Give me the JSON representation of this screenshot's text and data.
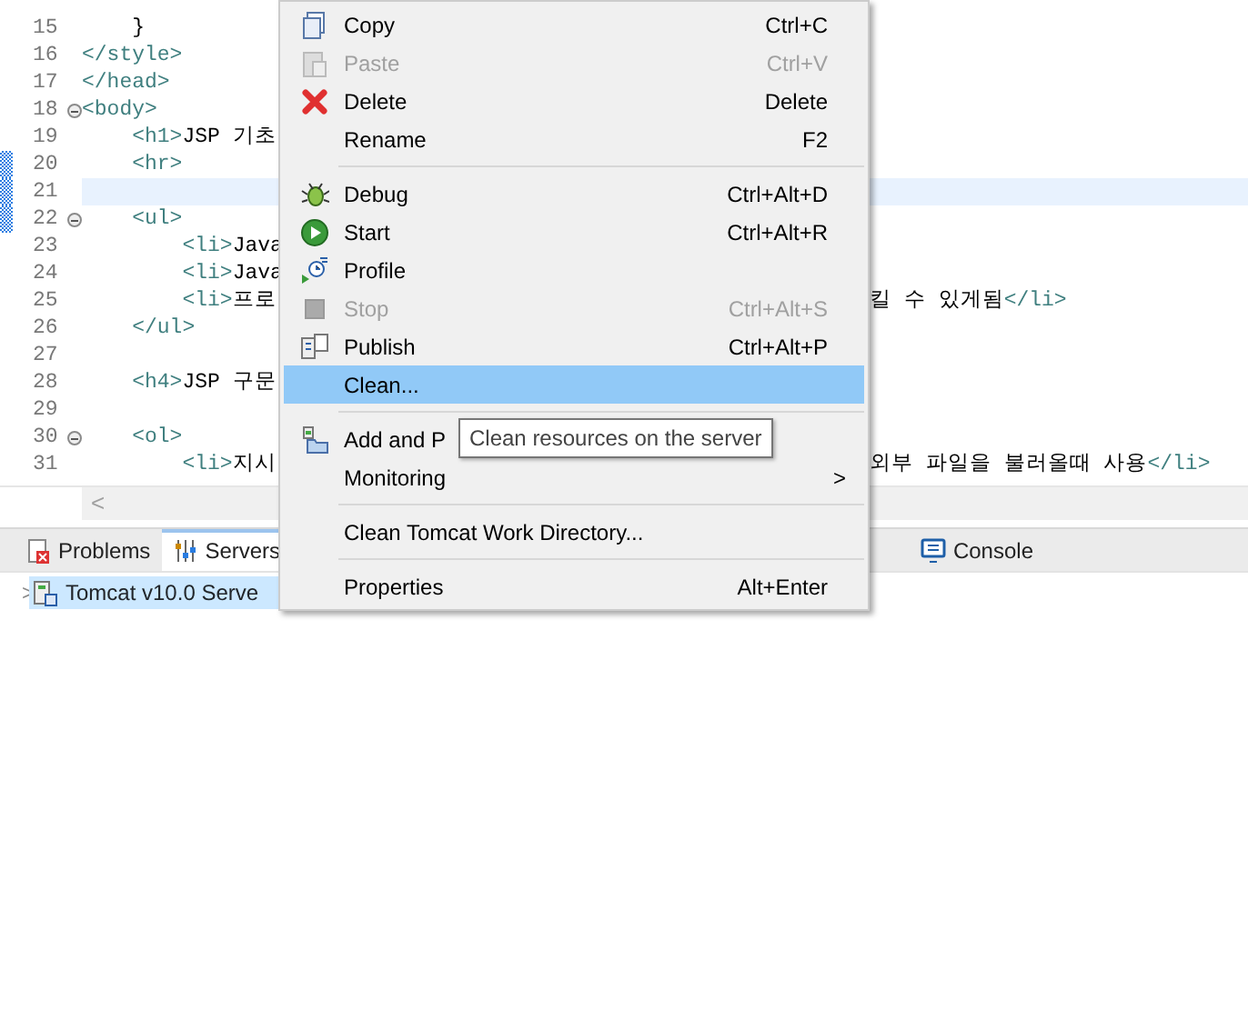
{
  "editor": {
    "lines": [
      {
        "number": "15",
        "left": [
          {
            "kind": "text",
            "text": "    }"
          }
        ],
        "collapsible": false,
        "changed": false,
        "current": false
      },
      {
        "number": "16",
        "left": [
          {
            "kind": "tag",
            "text": "</style>"
          }
        ],
        "collapsible": false,
        "changed": false,
        "current": false
      },
      {
        "number": "17",
        "left": [
          {
            "kind": "tag",
            "text": "</head>"
          }
        ],
        "collapsible": false,
        "changed": false,
        "current": false
      },
      {
        "number": "18",
        "left": [
          {
            "kind": "tag",
            "text": "<body>"
          }
        ],
        "collapsible": true,
        "changed": false,
        "current": false
      },
      {
        "number": "19",
        "left": [
          {
            "kind": "tag",
            "text": "    <h1>"
          },
          {
            "kind": "text",
            "text": "JSP 기초"
          }
        ],
        "collapsible": false,
        "changed": false,
        "current": false
      },
      {
        "number": "20",
        "left": [
          {
            "kind": "tag",
            "text": "    <hr>"
          }
        ],
        "collapsible": false,
        "changed": true,
        "current": false
      },
      {
        "number": "21",
        "collapsible": false,
        "changed": true,
        "current": true
      },
      {
        "number": "22",
        "left": [
          {
            "kind": "tag",
            "text": "    <ul>"
          }
        ],
        "collapsible": true,
        "changed": true,
        "current": false
      },
      {
        "number": "23",
        "left": [
          {
            "kind": "tag",
            "text": "        <li>"
          },
          {
            "kind": "text",
            "text": "Java"
          }
        ],
        "collapsible": false,
        "changed": false,
        "current": false
      },
      {
        "number": "24",
        "left": [
          {
            "kind": "tag",
            "text": "        <li>"
          },
          {
            "kind": "text",
            "text": "Java"
          }
        ],
        "collapsible": false,
        "changed": false,
        "current": false
      },
      {
        "number": "25",
        "left": [
          {
            "kind": "tag",
            "text": "        <li>"
          },
          {
            "kind": "text",
            "text": "프로"
          }
        ],
        "right": [
          {
            "kind": "text",
            "text": "킬 수 있게됨"
          },
          {
            "kind": "tag",
            "text": "</li>"
          }
        ],
        "collapsible": false,
        "changed": false,
        "current": false
      },
      {
        "number": "26",
        "left": [
          {
            "kind": "tag",
            "text": "    </ul>"
          }
        ],
        "collapsible": false,
        "changed": false,
        "current": false
      },
      {
        "number": "27",
        "collapsible": false,
        "changed": false,
        "current": false
      },
      {
        "number": "28",
        "left": [
          {
            "kind": "tag",
            "text": "    <h4>"
          },
          {
            "kind": "text",
            "text": "JSP 구문"
          }
        ],
        "collapsible": false,
        "changed": false,
        "current": false
      },
      {
        "number": "29",
        "collapsible": false,
        "changed": false,
        "current": false
      },
      {
        "number": "30",
        "left": [
          {
            "kind": "tag",
            "text": "    <ol>"
          }
        ],
        "collapsible": true,
        "changed": false,
        "current": false
      },
      {
        "number": "31",
        "left": [
          {
            "kind": "tag",
            "text": "        <li>"
          },
          {
            "kind": "text",
            "text": "지시"
          }
        ],
        "right": [
          {
            "kind": "text",
            "text": "외부 파일을 불러올때 사용"
          },
          {
            "kind": "tag",
            "text": "</li>"
          }
        ],
        "collapsible": false,
        "changed": false,
        "current": false
      }
    ],
    "scroll_left": "<"
  },
  "views": {
    "tabs": [
      {
        "label": "Problems",
        "selected": false
      },
      {
        "label": "Servers",
        "selected": true
      },
      {
        "label": "Console",
        "selected": false
      }
    ],
    "tree": [
      {
        "label": "Tomcat v10.0 Serve",
        "selected": true,
        "expanded": false,
        "toggle": ">"
      }
    ]
  },
  "context_menu": {
    "items": [
      {
        "kind": "item",
        "label": "Copy",
        "shortcut": "Ctrl+C",
        "disabled": false,
        "selected": false,
        "submenu": false
      },
      {
        "kind": "item",
        "label": "Paste",
        "shortcut": "Ctrl+V",
        "disabled": true,
        "selected": false,
        "submenu": false
      },
      {
        "kind": "item",
        "label": "Delete",
        "shortcut": "Delete",
        "disabled": false,
        "selected": false,
        "submenu": false
      },
      {
        "kind": "item",
        "label": "Rename",
        "shortcut": "F2",
        "disabled": false,
        "selected": false,
        "submenu": false
      },
      {
        "kind": "separator"
      },
      {
        "kind": "item",
        "label": "Debug",
        "shortcut": "Ctrl+Alt+D",
        "disabled": false,
        "selected": false,
        "submenu": false
      },
      {
        "kind": "item",
        "label": "Start",
        "shortcut": "Ctrl+Alt+R",
        "disabled": false,
        "selected": false,
        "submenu": false
      },
      {
        "kind": "item",
        "label": "Profile",
        "disabled": false,
        "selected": false,
        "submenu": false
      },
      {
        "kind": "item",
        "label": "Stop",
        "shortcut": "Ctrl+Alt+S",
        "disabled": true,
        "selected": false,
        "submenu": false
      },
      {
        "kind": "item",
        "label": "Publish",
        "shortcut": "Ctrl+Alt+P",
        "disabled": false,
        "selected": false,
        "submenu": false
      },
      {
        "kind": "item",
        "label": "Clean...",
        "disabled": false,
        "selected": true,
        "submenu": false
      },
      {
        "kind": "separator"
      },
      {
        "kind": "item",
        "label": "Add and P",
        "disabled": false,
        "selected": false,
        "submenu": false
      },
      {
        "kind": "item",
        "label": "Monitoring",
        "disabled": false,
        "selected": false,
        "submenu": true,
        "submenu_arrow": ">"
      },
      {
        "kind": "separator"
      },
      {
        "kind": "item",
        "label": "Clean Tomcat Work Directory...",
        "disabled": false,
        "selected": false,
        "submenu": false
      },
      {
        "kind": "separator"
      },
      {
        "kind": "item",
        "label": "Properties",
        "shortcut": "Alt+Enter",
        "disabled": false,
        "selected": false,
        "submenu": false
      }
    ]
  },
  "tooltip": {
    "text": "Clean resources on the server"
  }
}
